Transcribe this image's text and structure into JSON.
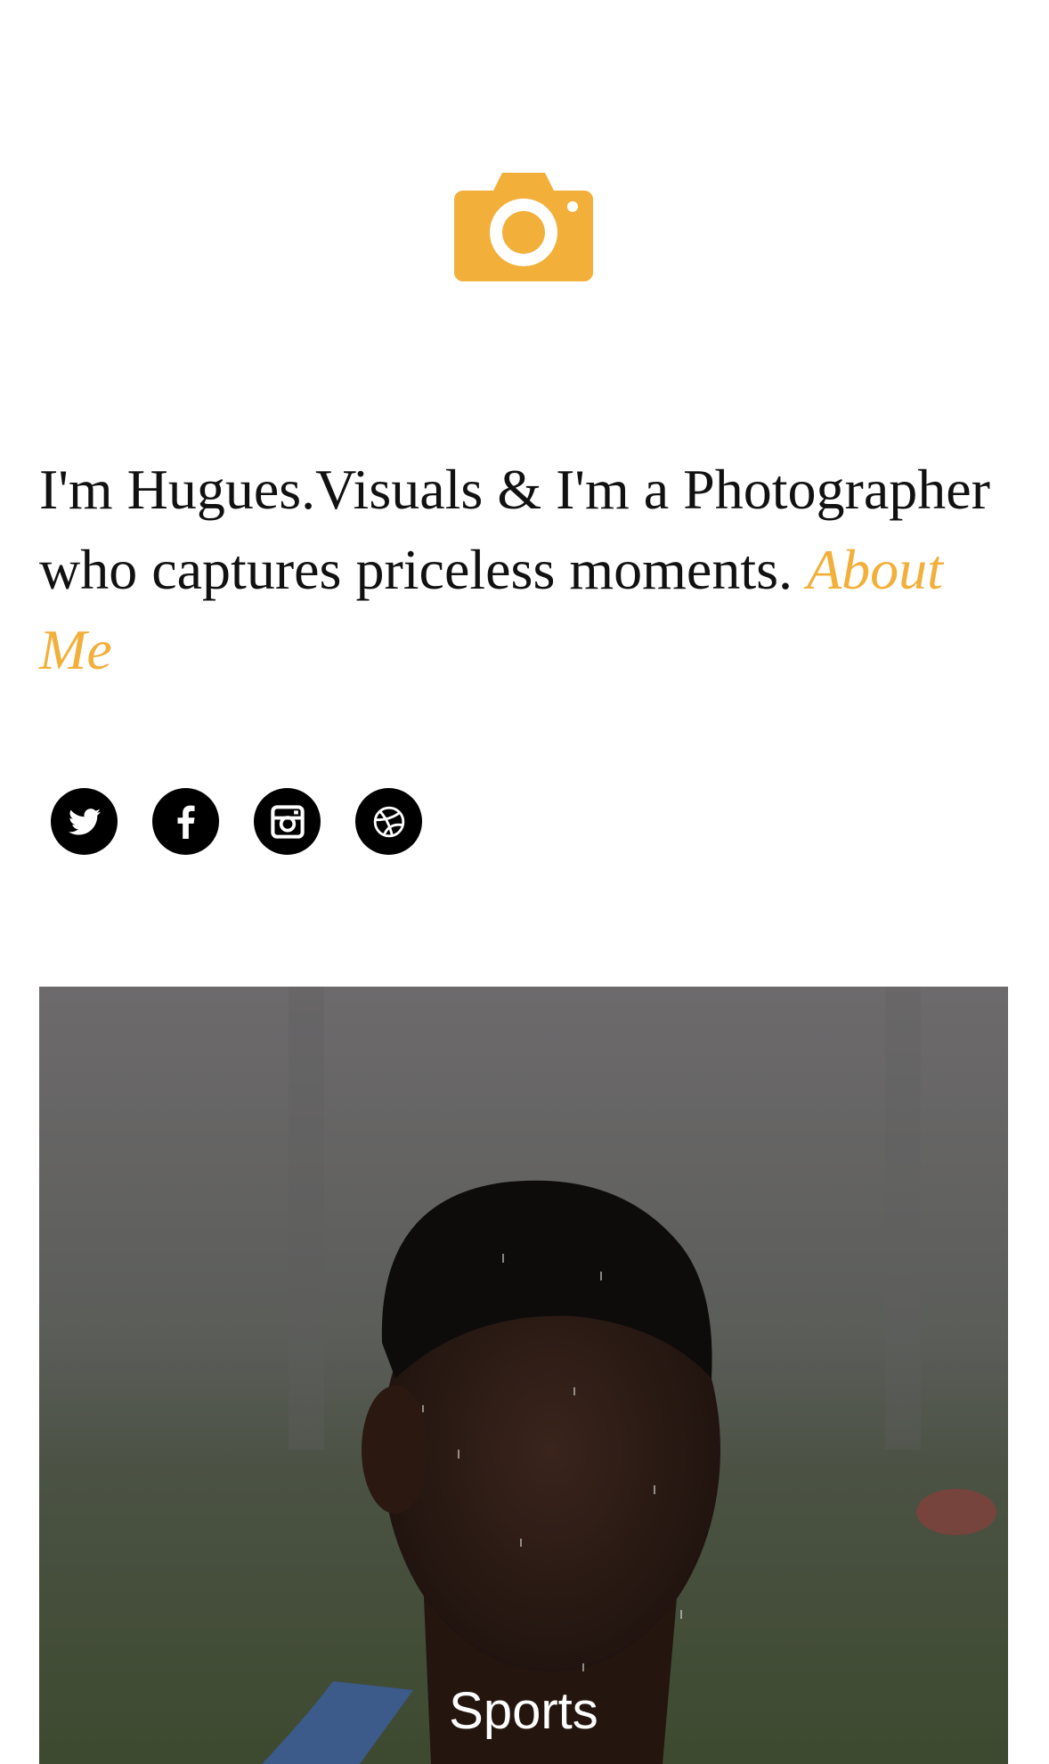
{
  "brand": {
    "logo_icon": "camera-icon",
    "accent_color": "#F2AF3A"
  },
  "intro": {
    "text": "I'm Hugues.Visuals & I'm a Photographer who captures priceless moments.",
    "about_link_label": "About Me"
  },
  "social": [
    {
      "name": "twitter-icon"
    },
    {
      "name": "facebook-icon"
    },
    {
      "name": "instagram-icon"
    },
    {
      "name": "dribbble-icon"
    }
  ],
  "gallery": {
    "items": [
      {
        "caption": "Sports"
      }
    ]
  }
}
